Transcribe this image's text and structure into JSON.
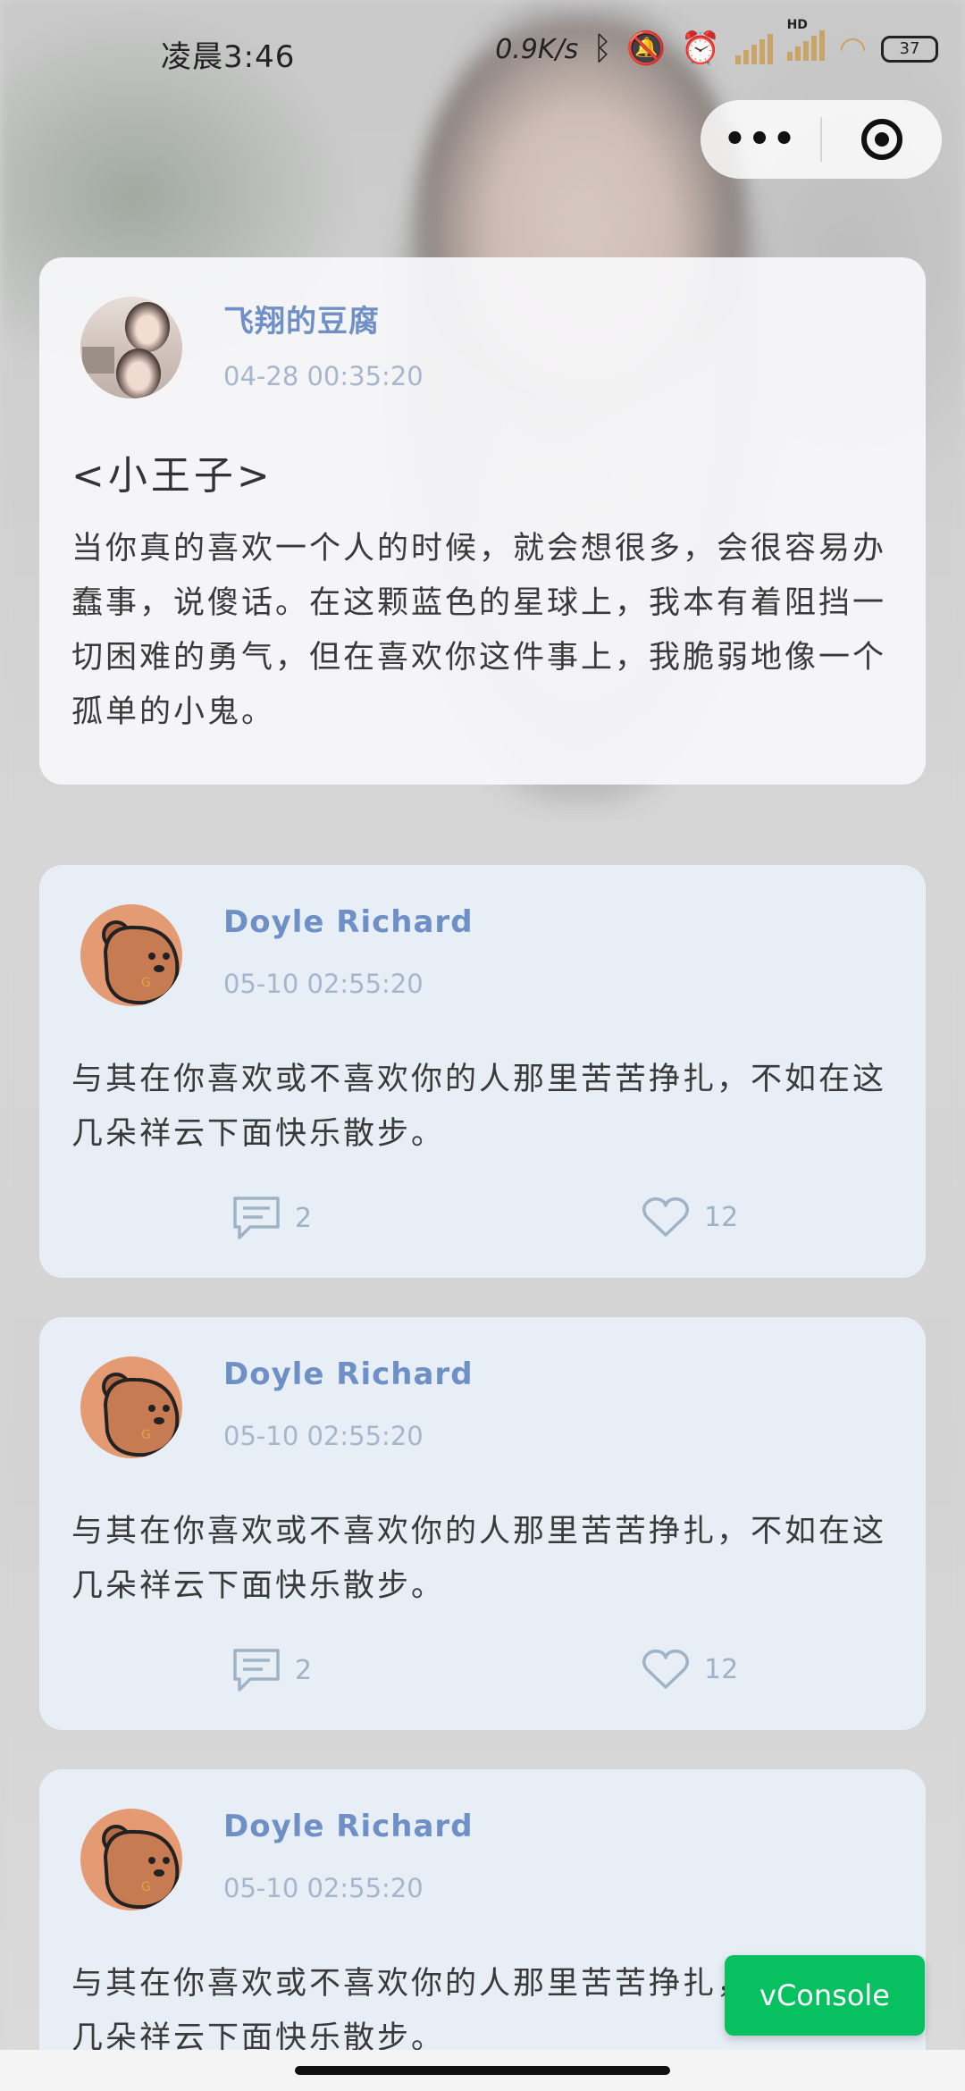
{
  "status_bar": {
    "time": "凌晨3:46",
    "net_speed": "0.9K/s",
    "battery": "37",
    "hd_label": "HD"
  },
  "capsule": {
    "more_label": "•••",
    "close_icon": "target-icon"
  },
  "featured_post": {
    "user_name": "飞翔的豆腐",
    "time": "04-28 00:35:20",
    "book_title": "<小王子>",
    "content": "当你真的喜欢一个人的时候，就会想很多，会很容易办蠢事，说傻话。在这颗蓝色的星球上，我本有着阻挡一切困难的勇气，但在喜欢你这件事上，我脆弱地像一个孤单的小鬼。"
  },
  "posts": [
    {
      "user_name": "Doyle Richard",
      "time": "05-10 02:55:20",
      "content": "与其在你喜欢或不喜欢你的人那里苦苦挣扎，不如在这几朵祥云下面快乐散步。",
      "comments": "2",
      "likes": "12"
    },
    {
      "user_name": "Doyle Richard",
      "time": "05-10 02:55:20",
      "content": "与其在你喜欢或不喜欢你的人那里苦苦挣扎，不如在这几朵祥云下面快乐散步。",
      "comments": "2",
      "likes": "12"
    },
    {
      "user_name": "Doyle Richard",
      "time": "05-10 02:55:20",
      "content": "与其在你喜欢或不喜欢你的人那里苦苦挣扎，不如在这几朵祥云下面快乐散步。"
    }
  ],
  "vconsole_label": "vConsole",
  "colors": {
    "accent_blue": "#6f90c6",
    "muted_blue": "#a6b7cd",
    "vconsole_green": "#07c160"
  }
}
